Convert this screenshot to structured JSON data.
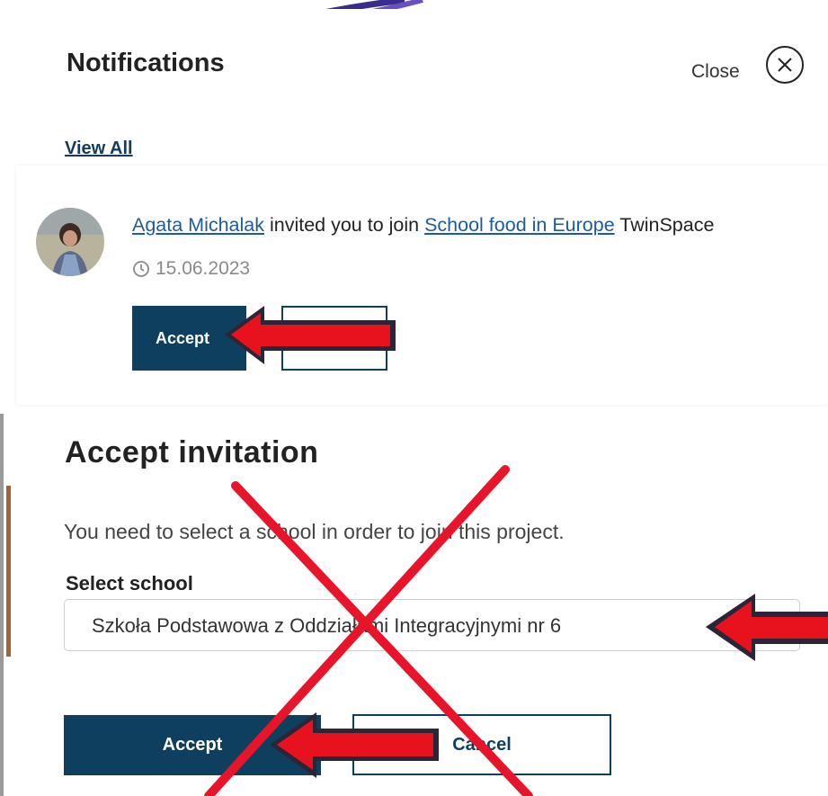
{
  "notifications": {
    "title": "Notifications",
    "close_label": "Close",
    "close_icon": "close-circle-icon",
    "view_all": "View All"
  },
  "notification_item": {
    "sender": "Agata Michalak",
    "message_mid": " invited you to join ",
    "project": "School food in Europe",
    "message_end": " TwinSpace",
    "date": "15.06.2023",
    "accept_label": "Accept",
    "decline_label": ""
  },
  "dialog": {
    "title": "Accept invitation",
    "message": "You need to select a school in order to join this project.",
    "select_label": "Select school",
    "select_value": "Szkoła Podstawowa z Oddziałami Integracyjnymi nr 6",
    "accept_label": "Accept",
    "cancel_label": "Cancel"
  },
  "annotations": {
    "arrow_color": "#e8121f",
    "cross_color": "#e8142a",
    "arrow_outline": "#2b2536"
  },
  "colors": {
    "primary": "#0e3f5e",
    "link": "#1d5a9f"
  }
}
